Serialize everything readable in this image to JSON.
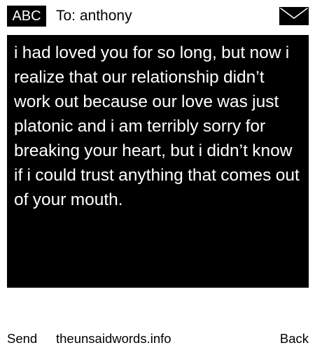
{
  "header": {
    "mode_label": "ABC",
    "recipient": "To: anthony",
    "icon": "envelope-icon"
  },
  "message": {
    "text": "i had loved you for so long, but now i realize that our relationship didn’t work out because our love was just platonic and i am terribly sorry for breaking your heart, but i didn’t know if i could trust anything that comes out of your mouth."
  },
  "footer": {
    "left_label": "Send",
    "center_label": "theunsaidwords.info",
    "right_label": "Back"
  },
  "colors": {
    "background": "#ffffff",
    "message_background": "#000000",
    "message_text": "#ffffff"
  }
}
